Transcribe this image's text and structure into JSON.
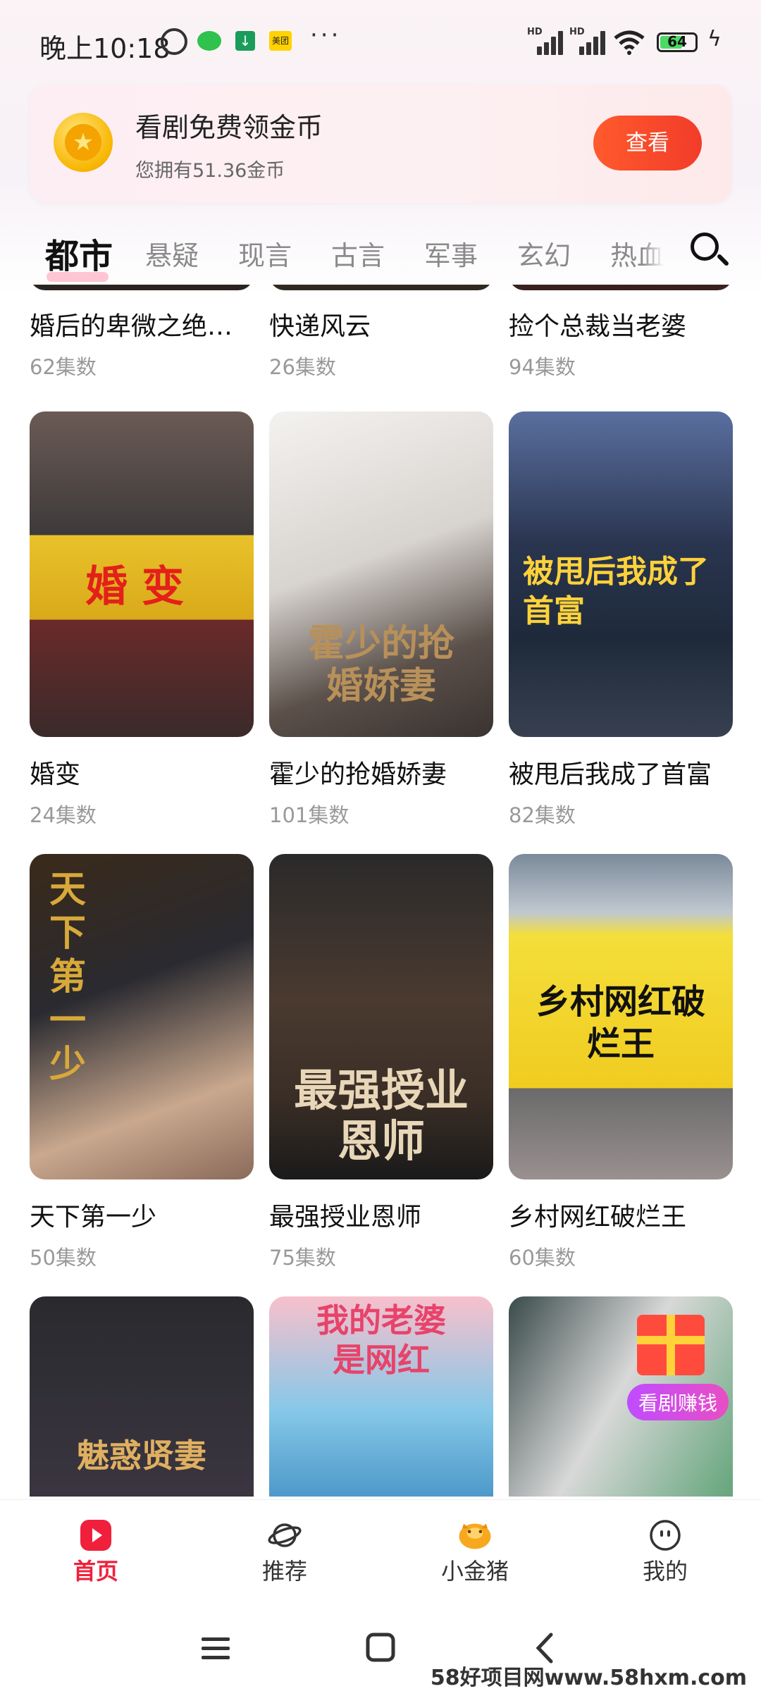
{
  "status_bar": {
    "time": "晚上10:18",
    "app_icon_meituan": "美团",
    "signal1_label": "HD",
    "signal2_label": "HD",
    "battery_level": "64",
    "icons": [
      "alarm-icon",
      "wechat-icon",
      "download-app-icon",
      "meituan-icon",
      "more-dots-icon",
      "signal-icon",
      "wifi-icon",
      "battery-icon",
      "charging-icon"
    ]
  },
  "coin_banner": {
    "title": "看剧免费领金币",
    "subtitle": "您拥有51.36金币",
    "button_label": "查看",
    "accent_color": "#f23c2a"
  },
  "tabs": [
    "都市",
    "悬疑",
    "现言",
    "古言",
    "军事",
    "玄幻",
    "热血"
  ],
  "active_tab": "都市",
  "dramas": [
    {
      "title": "婚后的卑微之绝…",
      "count": "62集数"
    },
    {
      "title": "快递风云",
      "count": "26集数"
    },
    {
      "title": "捡个总裁当老婆",
      "count": "94集数"
    },
    {
      "title": "婚变",
      "count": "24集数",
      "poster_text": "婚变"
    },
    {
      "title": "霍少的抢婚娇妻",
      "count": "101集数",
      "poster_text": "霍少的抢婚娇妻"
    },
    {
      "title": "被甩后我成了首富",
      "count": "82集数",
      "poster_text": "被甩后我成了首富"
    },
    {
      "title": "天下第一少",
      "count": "50集数",
      "poster_text": "天下第一少"
    },
    {
      "title": "最强授业恩师",
      "count": "75集数",
      "poster_text": "最强授业恩师"
    },
    {
      "title": "乡村网红破烂王",
      "count": "60集数",
      "poster_text": "乡村网红破烂王"
    },
    {
      "title": "",
      "count": "",
      "poster_text": "魅惑贤妻"
    },
    {
      "title": "",
      "count": "",
      "poster_text": "我的老婆是网红"
    },
    {
      "title": "",
      "count": "",
      "poster_badge": "看剧赚钱"
    }
  ],
  "bottom_nav": [
    {
      "label": "首页",
      "icon": "play-icon",
      "active": true
    },
    {
      "label": "推荐",
      "icon": "planet-icon",
      "active": false
    },
    {
      "label": "小金猪",
      "icon": "piggy-bank-icon",
      "active": false
    },
    {
      "label": "我的",
      "icon": "face-icon",
      "active": false
    }
  ],
  "watermark": "58好项目网www.58hxm.com"
}
